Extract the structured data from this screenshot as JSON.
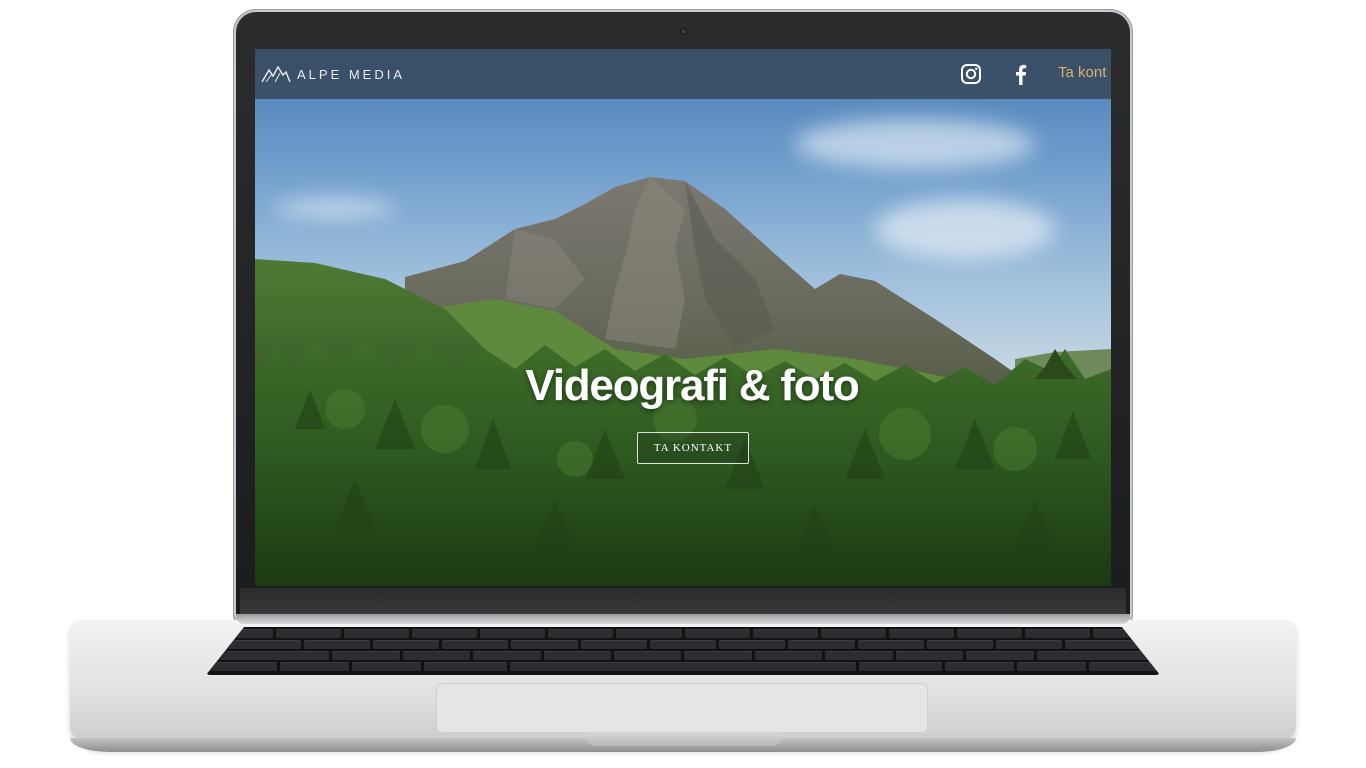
{
  "site": {
    "logo_text": "ALPE MEDIA",
    "nav": {
      "instagram_icon": "instagram-icon",
      "facebook_icon": "facebook-icon",
      "contact_link": "Ta kont"
    },
    "hero": {
      "title": "Videografi & foto",
      "cta_label": "TA KONTAKT"
    }
  },
  "colors": {
    "navbar": "#344252",
    "contact_link": "#d9b36a",
    "title": "#ffffff"
  }
}
